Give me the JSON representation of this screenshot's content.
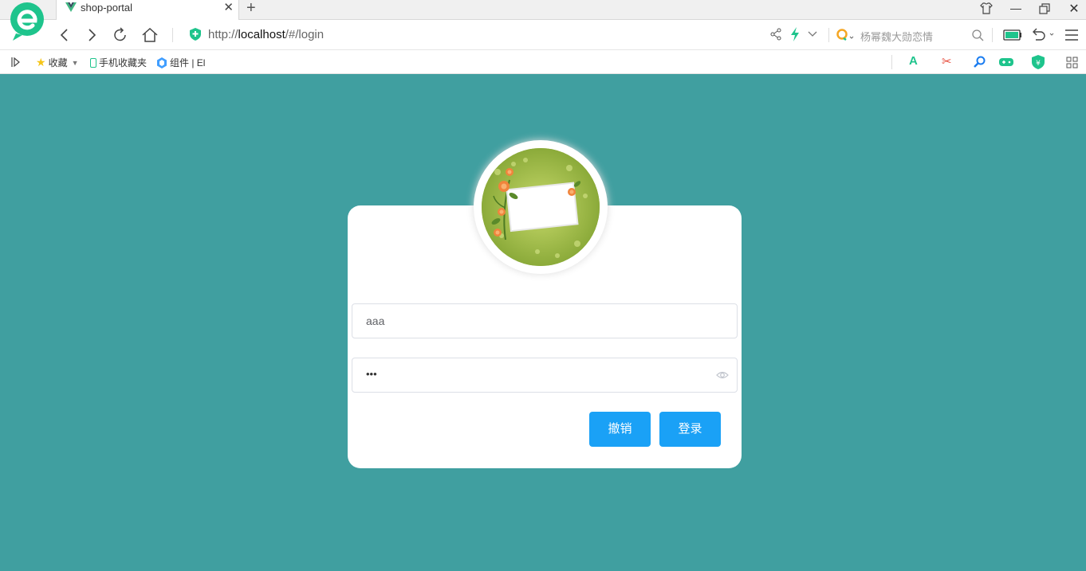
{
  "browser": {
    "tab": {
      "title": "shop-portal"
    },
    "address": {
      "scheme": "http://",
      "host": "localhost",
      "path": "/#/login"
    },
    "search": {
      "placeholder": "杨幂魏大勋恋情"
    },
    "bookmarks": [
      {
        "label": "收藏"
      },
      {
        "label": "手机收藏夹"
      },
      {
        "label": "组件 | El"
      }
    ],
    "colors": {
      "logo": "#1ec48c",
      "accent": "#1aa1f6"
    }
  },
  "login": {
    "username": {
      "value": "aaa"
    },
    "password": {
      "masked": "•••"
    },
    "cancel_label": "撤销",
    "login_label": "登录"
  },
  "colors": {
    "page_background": "#409fa0",
    "button": "#1aa1f6"
  }
}
